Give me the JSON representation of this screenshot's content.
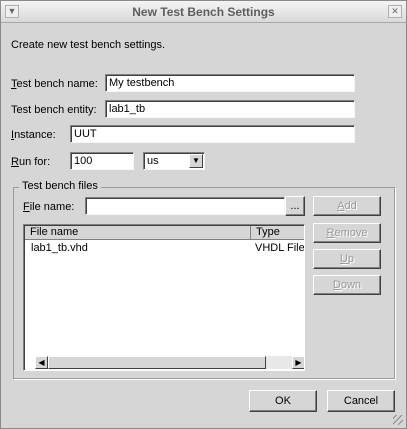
{
  "window": {
    "title": "New Test Bench Settings",
    "menu_icon": "chevron-down-icon",
    "close_icon": "close-icon"
  },
  "description": "Create new test bench settings.",
  "form": {
    "test_bench_name": {
      "label_mnemonic": "T",
      "label_rest": "est bench name:",
      "value": "My testbench"
    },
    "test_bench_entity": {
      "label": "Test bench entity:",
      "value": "lab1_tb"
    },
    "instance": {
      "label_mnemonic": "I",
      "label_rest": "nstance:",
      "value": "UUT"
    },
    "run_for": {
      "label_mnemonic": "R",
      "label_rest": "un for:",
      "value": "100",
      "unit": "us"
    }
  },
  "files_group": {
    "title": "Test bench files",
    "file_name": {
      "label_mnemonic": "F",
      "label_rest": "ile name:",
      "value": "",
      "browse_label": "..."
    },
    "columns": [
      "File name",
      "Type"
    ],
    "rows": [
      {
        "file": "lab1_tb.vhd",
        "type": "VHDL File"
      }
    ],
    "buttons": {
      "add": {
        "mnemonic": "A",
        "rest": "dd"
      },
      "remove": {
        "mnemonic": "R",
        "rest": "emove"
      },
      "up": {
        "mnemonic": "U",
        "rest": "p"
      },
      "down": {
        "mnemonic": "D",
        "rest": "own"
      }
    }
  },
  "footer": {
    "ok": "OK",
    "cancel": "Cancel"
  }
}
